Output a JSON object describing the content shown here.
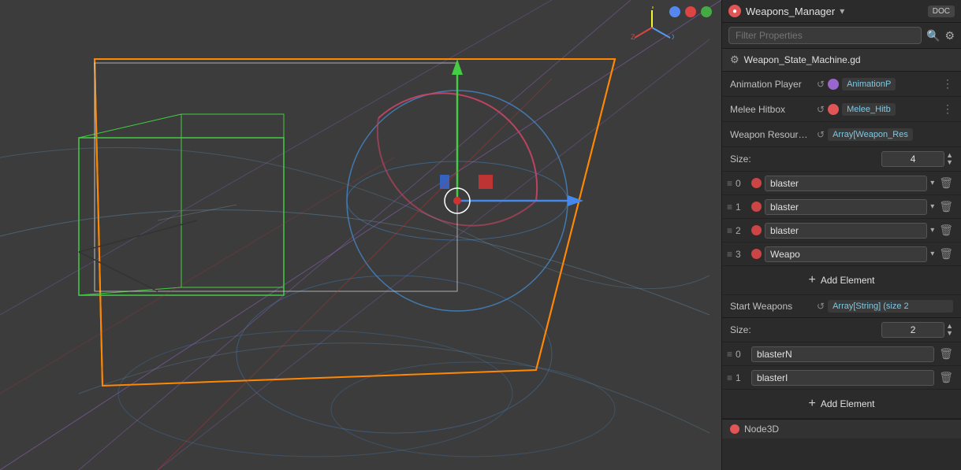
{
  "viewport": {
    "background": "#3c3c3c"
  },
  "header": {
    "node_name": "Weapons_Manager",
    "dropdown_label": "▾",
    "doc_label": "DOC"
  },
  "filter": {
    "placeholder": "Filter Properties",
    "search_icon": "🔍",
    "settings_icon": "⚙"
  },
  "script": {
    "name": "Weapon_State_Machine.gd",
    "gear_icon": "⚙"
  },
  "properties": [
    {
      "label": "Animation Player",
      "value_text": "AnimationP",
      "has_icon": true,
      "icon_color": "purple",
      "has_more": true
    },
    {
      "label": "Melee Hitbox",
      "value_text": "Melee_Hitb",
      "has_icon": true,
      "icon_color": "red",
      "has_more": true
    },
    {
      "label": "Weapon Resour…",
      "value_text": "Array[Weapon_Res",
      "has_icon": false,
      "has_more": false
    }
  ],
  "weapon_resources": {
    "size_label": "Size:",
    "size_value": "4",
    "items": [
      {
        "index": "0",
        "icon_color": "red",
        "value": "blaster",
        "has_dropdown": true
      },
      {
        "index": "1",
        "icon_color": "red",
        "value": "blaster",
        "has_dropdown": true
      },
      {
        "index": "2",
        "icon_color": "red",
        "value": "blaster",
        "has_dropdown": true
      },
      {
        "index": "3",
        "icon_color": "red",
        "value": "Weapo",
        "has_dropdown": true
      }
    ],
    "add_label": "Add Element"
  },
  "start_weapons": {
    "label": "Start Weapons",
    "value_text": "Array[String] (size 2",
    "size_label": "Size:",
    "size_value": "2",
    "items": [
      {
        "index": "0",
        "value": "blasterN"
      },
      {
        "index": "1",
        "value": "blasterI"
      }
    ],
    "add_label": "Add Element"
  },
  "node3d": {
    "label": "Node3D"
  },
  "axis": {
    "y_color": "#f5f530",
    "x_color": "#5599ee",
    "z_color": "#dd4444",
    "green_dot": "#55b055"
  }
}
